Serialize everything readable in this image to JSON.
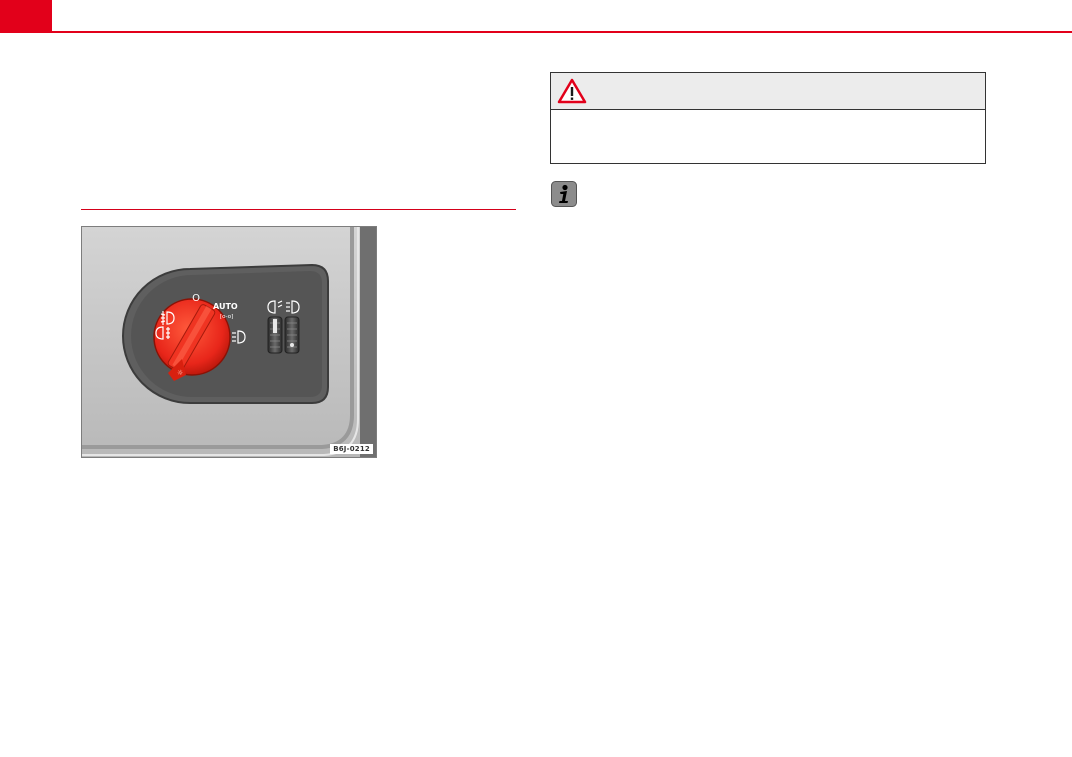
{
  "page": {
    "accent_color": "#e2001a"
  },
  "figure": {
    "code": "B6J-0212",
    "symbols": {
      "off": "O",
      "auto": "AUTO",
      "auto_sub": "[o-o]"
    },
    "knob_color": "#e8261a",
    "icons": [
      "headlight-beam-icon",
      "rear-fog-light-icon",
      "front-fog-light-icon",
      "side-light-icon",
      "headlight-range-icon",
      "instrument-lighting-icon"
    ]
  },
  "warning": {
    "icon": "warning-triangle-icon"
  },
  "note": {
    "icon": "info-icon"
  }
}
